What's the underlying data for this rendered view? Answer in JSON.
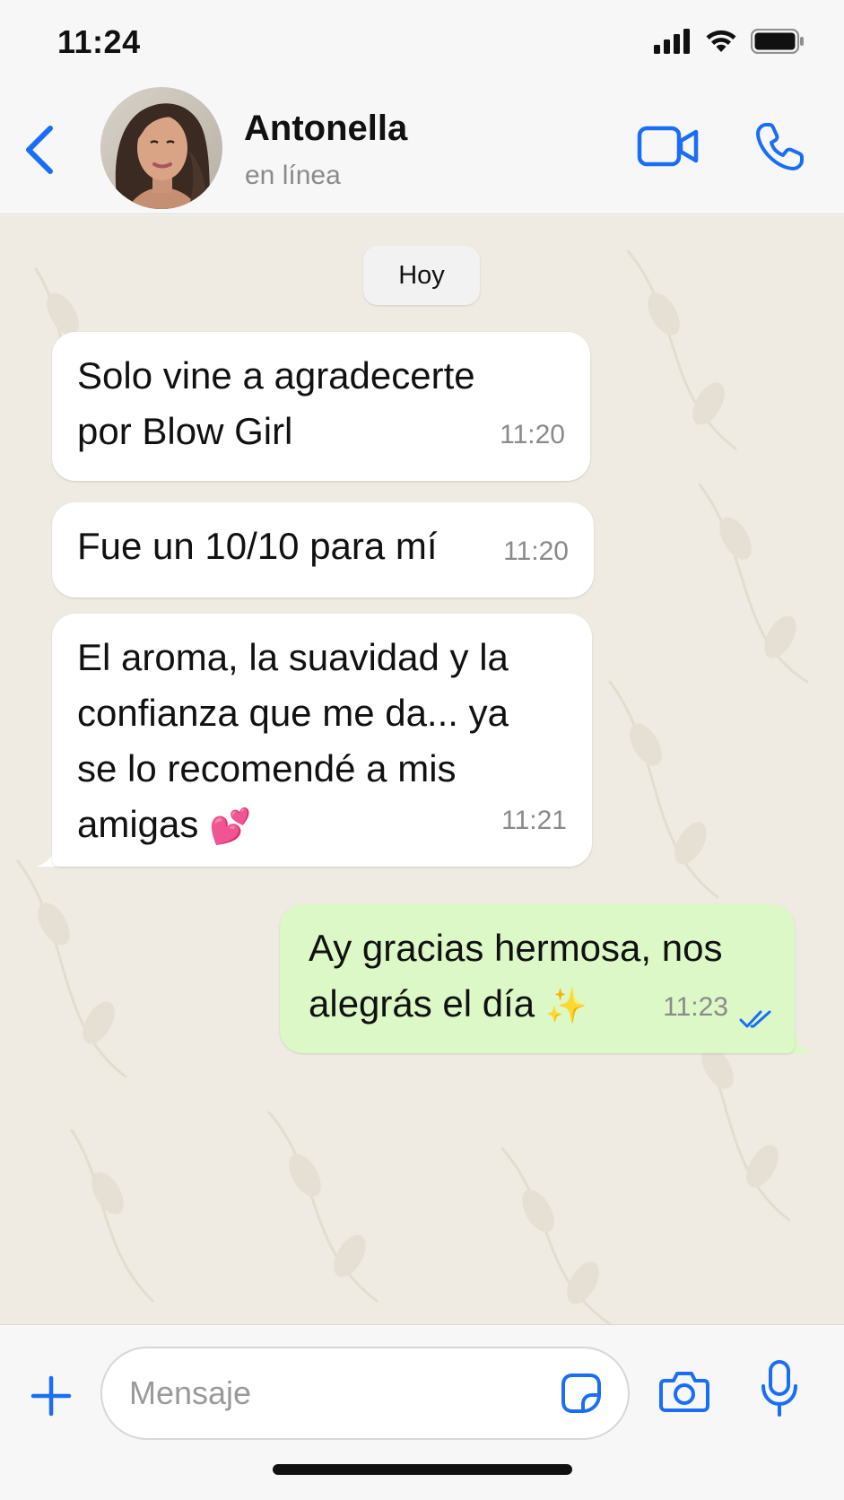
{
  "status_bar": {
    "time": "11:24"
  },
  "header": {
    "contact_name": "Antonella",
    "contact_status": "en línea"
  },
  "chat": {
    "day_label": "Hoy",
    "messages": [
      {
        "direction": "incoming",
        "text": "Solo vine a agradecerte\npor Blow Girl",
        "time": "11:20"
      },
      {
        "direction": "incoming",
        "text": "Fue un 10/10 para mí",
        "time": "11:20"
      },
      {
        "direction": "incoming",
        "text": "El aroma, la suavidad y la\nconfianza que me da... ya\nse lo recomendé a mis\namigas",
        "emoji": "💕",
        "time": "11:21"
      },
      {
        "direction": "outgoing",
        "text": "Ay gracias hermosa, nos\nalegrás el día",
        "emoji": "✨",
        "time": "11:23",
        "status": "read"
      }
    ]
  },
  "input": {
    "placeholder": "Mensaje"
  },
  "colors": {
    "accent": "#1a6ef5",
    "outgoing_bubble": "#dcf8c6",
    "incoming_bubble": "#ffffff",
    "wallpaper": "#efebe2"
  },
  "icons": [
    "back-chevron-icon",
    "video-call-icon",
    "phone-icon",
    "plus-icon",
    "sticker-icon",
    "camera-icon",
    "microphone-icon",
    "double-check-icon",
    "signal-icon",
    "wifi-icon",
    "battery-icon"
  ]
}
